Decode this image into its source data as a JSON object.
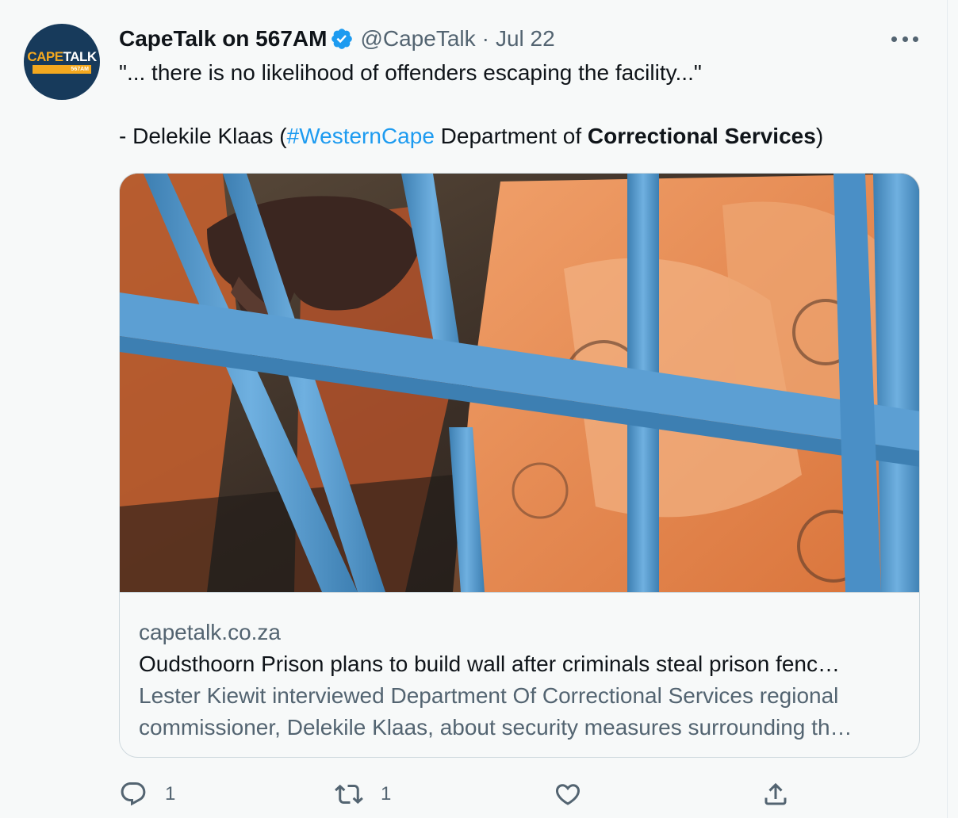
{
  "tweet": {
    "avatar": {
      "logo_cape": "CAPE",
      "logo_talk": "TALK",
      "logo_freq": "567AM"
    },
    "display_name": "CapeTalk on 567AM",
    "handle": "@CapeTalk",
    "separator": "·",
    "date": "Jul 22",
    "text": {
      "line1": "\"... there is no likelihood of offenders escaping the facility...\"",
      "line2_prefix": "- Delekile Klaas (",
      "hashtag": "#WesternCape",
      "line2_middle": " Department of ",
      "line2_bold": "Correctional Services",
      "line2_suffix": ")"
    },
    "card": {
      "image_description_icon": "prison-bars-photo",
      "domain": "capetalk.co.za",
      "title": "Oudsthoorn Prison plans to build wall after criminals steal prison fenc…",
      "description": "Lester Kiewit interviewed Department Of Correctional Services regional commissioner, Delekile Klaas, about security measures surrounding th…"
    },
    "actions": {
      "reply_count": "1",
      "retweet_count": "1",
      "like_count": "",
      "share_count": ""
    }
  },
  "colors": {
    "background": "#f7f9f9",
    "accent": "#1d9bf0",
    "muted": "#536471",
    "text": "#0f1419",
    "brand_navy": "#173a5b",
    "brand_orange": "#f3a81f"
  }
}
